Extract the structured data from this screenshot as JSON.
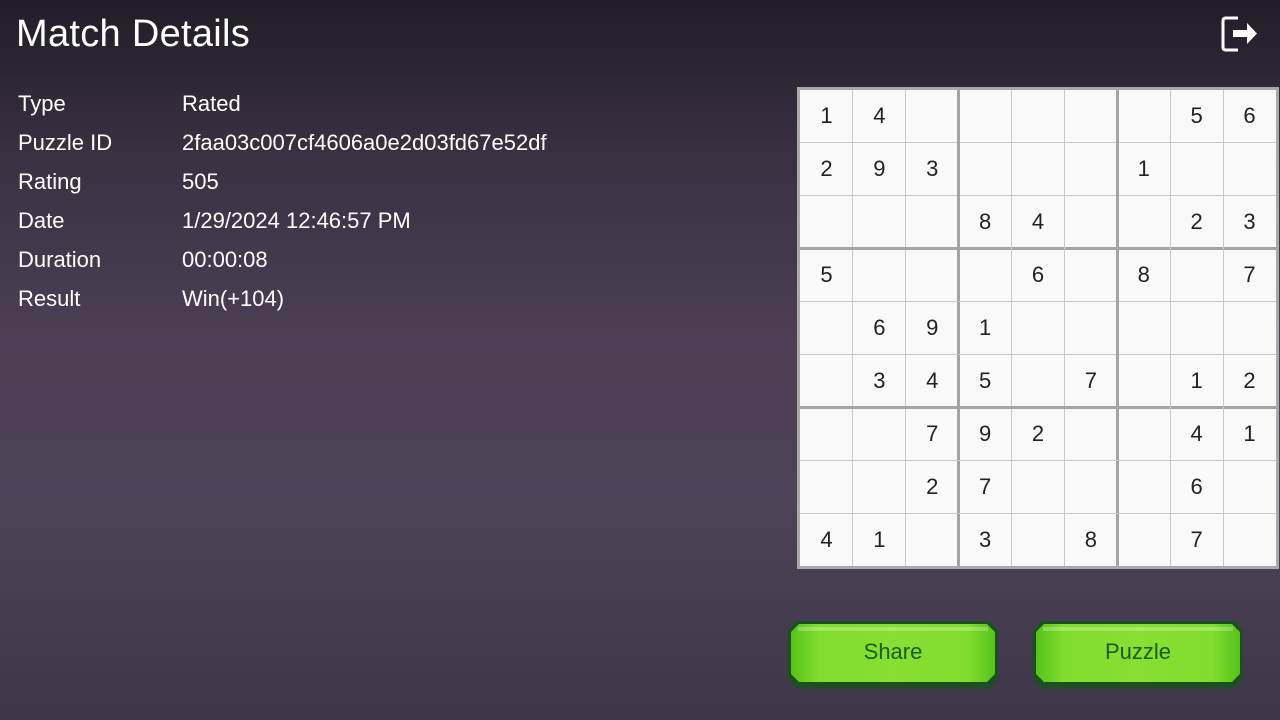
{
  "header": {
    "title": "Match Details",
    "exit_icon": "exit-icon"
  },
  "details": [
    {
      "label": "Type",
      "value": "Rated"
    },
    {
      "label": "Puzzle ID",
      "value": "2faa03c007cf4606a0e2d03fd67e52df"
    },
    {
      "label": "Rating",
      "value": "505"
    },
    {
      "label": "Date",
      "value": "1/29/2024 12:46:57 PM"
    },
    {
      "label": "Duration",
      "value": "00:00:08"
    },
    {
      "label": "Result",
      "value": "Win(+104)"
    }
  ],
  "board": {
    "grid": [
      [
        "1",
        "4",
        "",
        "",
        "",
        "",
        "",
        "5",
        "6"
      ],
      [
        "2",
        "9",
        "3",
        "",
        "",
        "",
        "1",
        "",
        ""
      ],
      [
        "",
        "",
        "",
        "8",
        "4",
        "",
        "",
        "2",
        "3"
      ],
      [
        "5",
        "",
        "",
        "",
        "6",
        "",
        "8",
        "",
        "7"
      ],
      [
        "",
        "6",
        "9",
        "1",
        "",
        "",
        "",
        "",
        ""
      ],
      [
        "",
        "3",
        "4",
        "5",
        "",
        "7",
        "",
        "1",
        "2"
      ],
      [
        "",
        "",
        "7",
        "9",
        "2",
        "",
        "",
        "4",
        "1"
      ],
      [
        "",
        "",
        "2",
        "7",
        "",
        "",
        "",
        "6",
        ""
      ],
      [
        "4",
        "1",
        "",
        "3",
        "",
        "8",
        "",
        "7",
        ""
      ]
    ]
  },
  "buttons": {
    "share_label": "Share",
    "puzzle_label": "Puzzle"
  },
  "colors": {
    "button_green": "#82de2e",
    "button_text": "#1e5a22",
    "board_background": "#f9f9f9",
    "board_border": "#a9a9a9"
  }
}
